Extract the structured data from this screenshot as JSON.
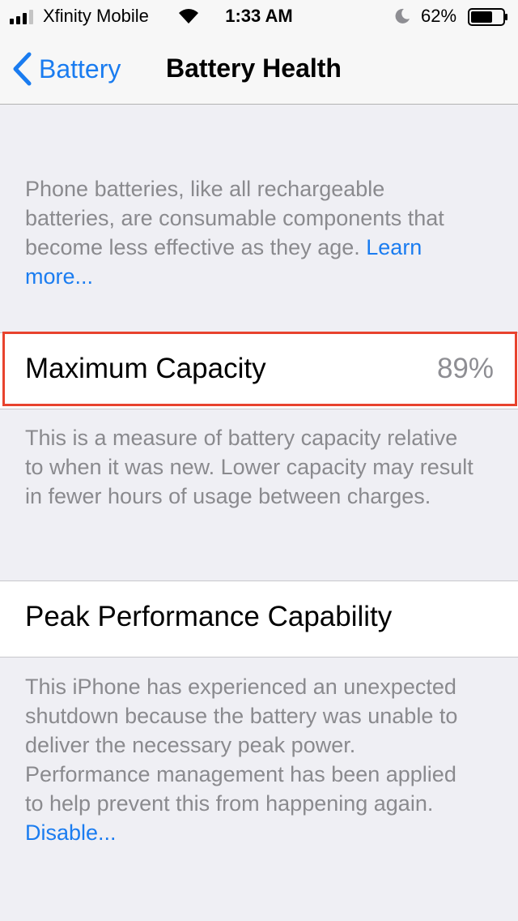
{
  "status_bar": {
    "carrier": "Xfinity Mobile",
    "time": "1:33 AM",
    "battery_percent": "62%",
    "icons": [
      "signal-icon",
      "wifi-icon",
      "moon-icon",
      "battery-icon"
    ]
  },
  "nav": {
    "back_label": "Battery",
    "title": "Battery Health"
  },
  "intro": {
    "text": "Phone batteries, like all rechargeable batteries, are consumable components that become less effective as they age.",
    "link": "Learn more..."
  },
  "max_capacity": {
    "label": "Maximum Capacity",
    "value": "89%",
    "description": "This is a measure of battery capacity relative to when it was new. Lower capacity may result in fewer hours of usage between charges."
  },
  "peak_performance": {
    "label": "Peak Performance Capability",
    "description": "This iPhone has experienced an unexpected shutdown because the battery was unable to deliver the necessary peak power. Performance management has been applied to help prevent this from happening again.",
    "link": "Disable..."
  },
  "colors": {
    "accent": "#1a7cf0",
    "highlight": "#e8432e",
    "background": "#efeff4",
    "secondary_text": "#8a8a8e"
  }
}
